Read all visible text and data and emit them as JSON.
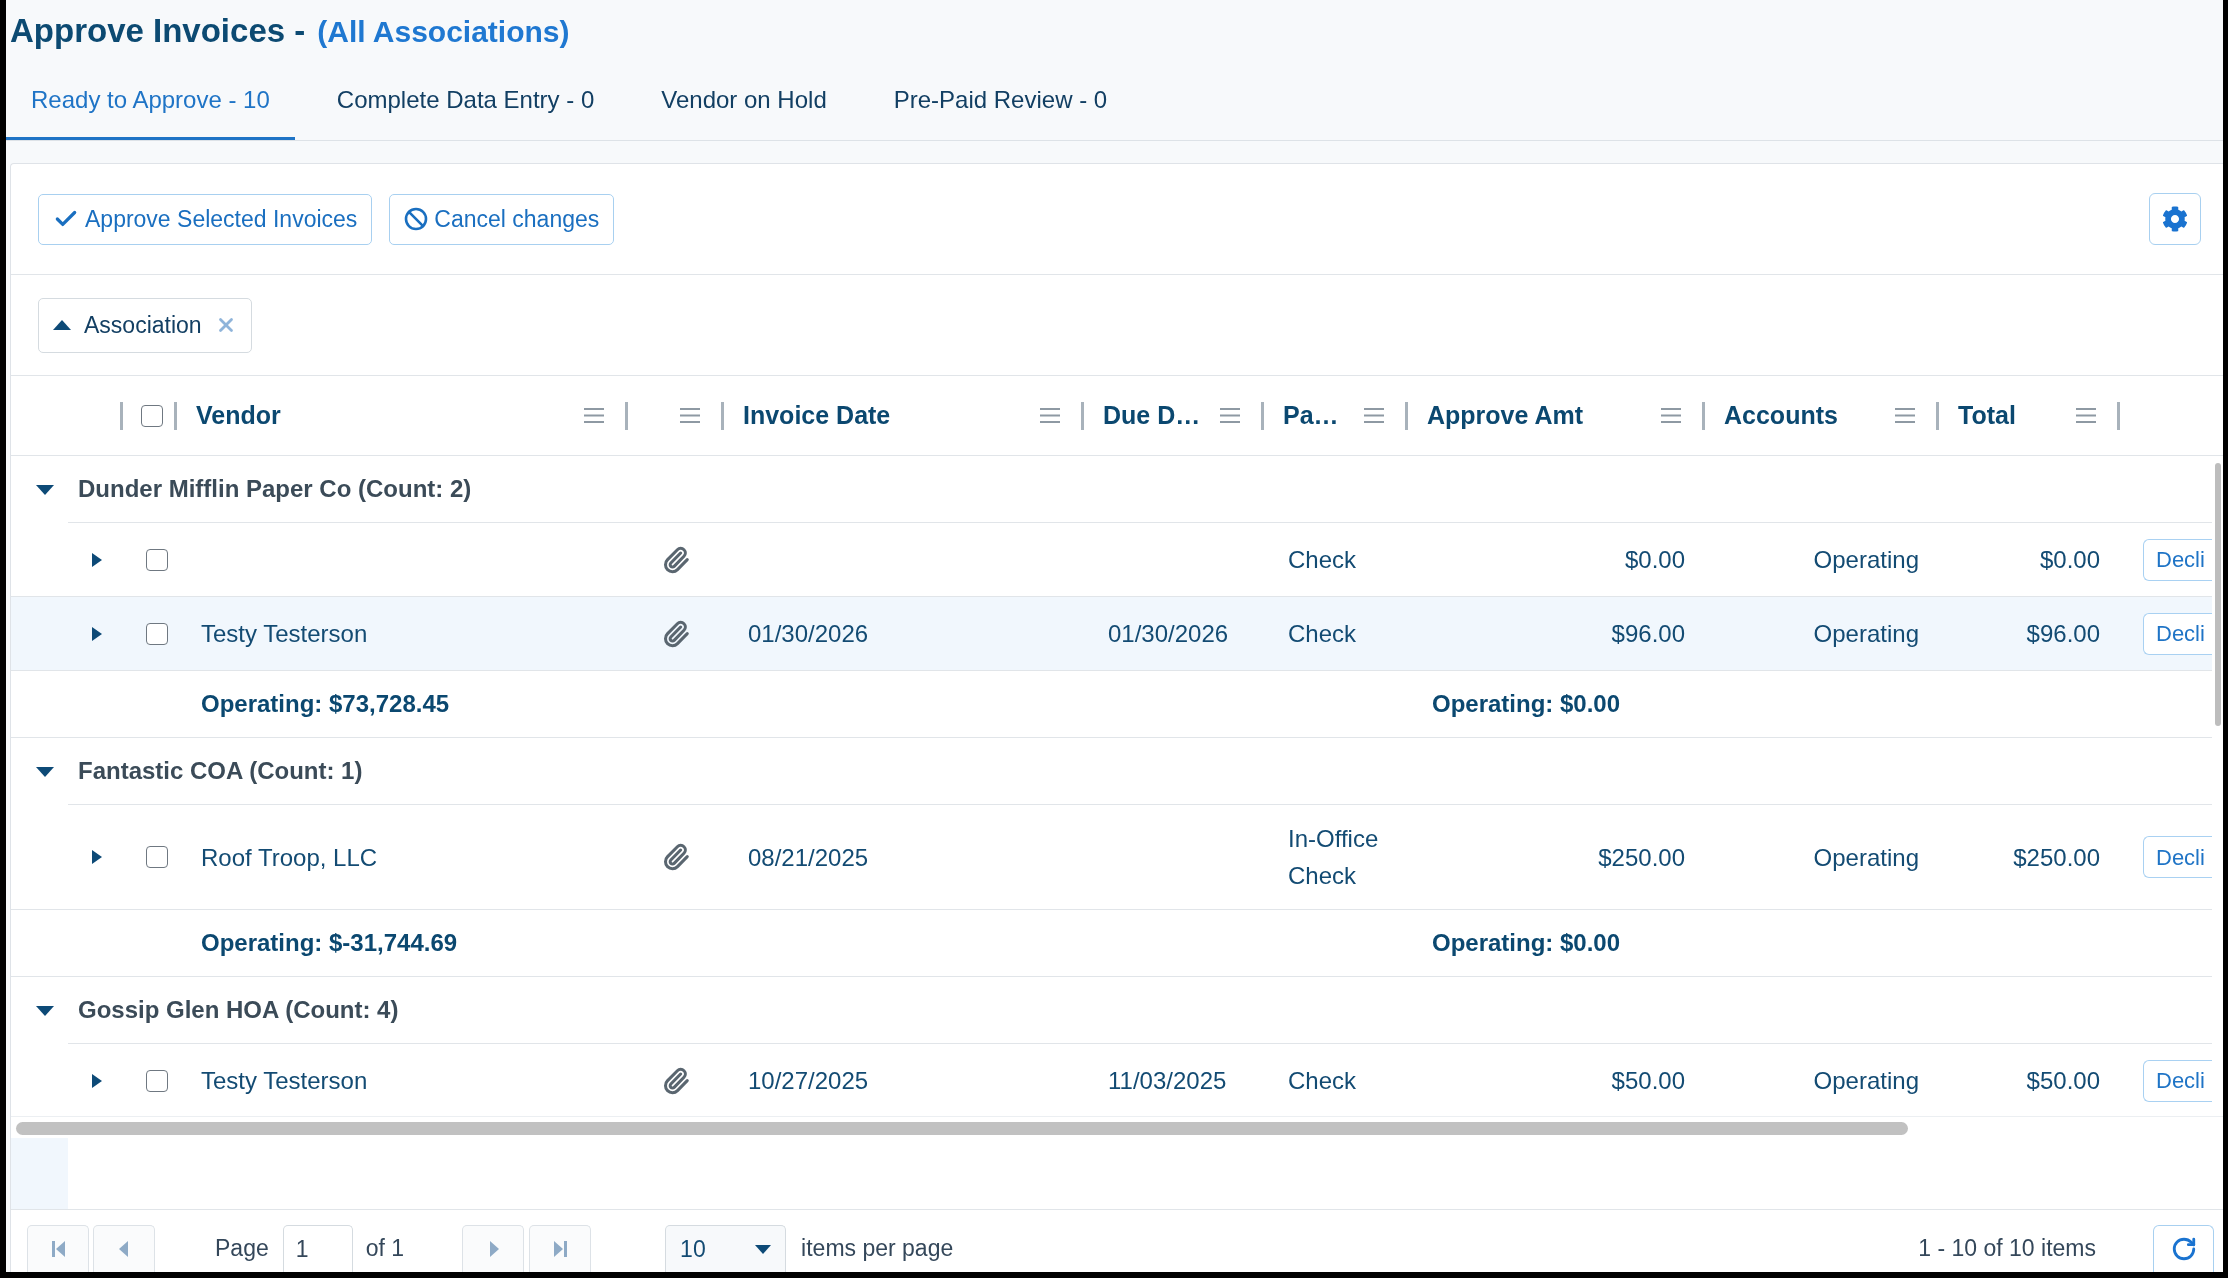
{
  "header": {
    "title": "Approve Invoices -",
    "scope": "(All Associations)"
  },
  "tabs": [
    {
      "label": "Ready to Approve - 10",
      "selected": true
    },
    {
      "label": "Complete Data Entry - 0",
      "selected": false
    },
    {
      "label": "Vendor on Hold",
      "selected": false
    },
    {
      "label": "Pre-Paid Review - 0",
      "selected": false
    }
  ],
  "toolbar": {
    "buttons": [
      {
        "kind": "approve",
        "label": "Approve Selected Invoices"
      },
      {
        "kind": "cancel",
        "label": "Cancel changes"
      }
    ]
  },
  "grouping": {
    "chips": [
      {
        "label": "Association",
        "ascending": true
      }
    ]
  },
  "table": {
    "select_all_checked": false,
    "columns": [
      {
        "kind": "text",
        "label": "Vendor"
      },
      {
        "kind": "blank"
      },
      {
        "kind": "text",
        "label": "Invoice Date"
      },
      {
        "kind": "text",
        "label": "Due D…"
      },
      {
        "kind": "text",
        "label": "Pa…"
      },
      {
        "kind": "text",
        "label": "Approve Amt"
      },
      {
        "kind": "text",
        "label": "Accounts"
      },
      {
        "kind": "text",
        "label": "Total"
      }
    ],
    "groups": [
      {
        "title": "Dunder Mifflin Paper Co (Count: 2)",
        "expanded": true,
        "rows": [
          {
            "expanded": false,
            "checked": false,
            "highlighted": false,
            "attachment": true,
            "payment": "Check",
            "approve_amt": "$0.00",
            "account": "Operating",
            "total": "$0.00",
            "action": "Decli"
          },
          {
            "expanded": false,
            "checked": false,
            "highlighted": true,
            "vendor": "Testy Testerson",
            "attachment": true,
            "invoice_date": "01/30/2026",
            "due_date": "01/30/2026",
            "payment": "Check",
            "approve_amt": "$96.00",
            "account": "Operating",
            "total": "$96.00",
            "action": "Decli"
          }
        ],
        "totals": {
          "vendor": "Operating: $73,728.45",
          "approve_amt": "Operating: $0.00"
        }
      },
      {
        "title": "Fantastic COA (Count: 1)",
        "expanded": true,
        "rows": [
          {
            "expanded": false,
            "checked": false,
            "highlighted": false,
            "vendor": "Roof Troop, LLC",
            "attachment": true,
            "invoice_date": "08/21/2025",
            "payment": "In-Office Check",
            "approve_amt": "$250.00",
            "account": "Operating",
            "total": "$250.00",
            "action": "Decli"
          }
        ],
        "totals": {
          "vendor": "Operating: $-31,744.69",
          "approve_amt": "Operating: $0.00"
        }
      },
      {
        "title": "Gossip Glen HOA (Count: 4)",
        "expanded": true,
        "rows": [
          {
            "expanded": false,
            "checked": false,
            "highlighted": false,
            "vendor": "Testy Testerson",
            "attachment": true,
            "invoice_date": "10/27/2025",
            "due_date": "11/03/2025",
            "payment": "Check",
            "approve_amt": "$50.00",
            "account": "Operating",
            "total": "$50.00",
            "action": "Decli"
          }
        ]
      }
    ]
  },
  "pager": {
    "nav": [
      {
        "kind": "first",
        "disabled": true
      },
      {
        "kind": "prev",
        "disabled": true
      },
      {
        "kind": "next",
        "disabled": true
      },
      {
        "kind": "last",
        "disabled": true
      }
    ],
    "page_label": "Page",
    "page": "1",
    "of_label": "of 1",
    "page_size": "10",
    "size_label": "items per page",
    "summary": "1 - 10 of 10 items"
  }
}
